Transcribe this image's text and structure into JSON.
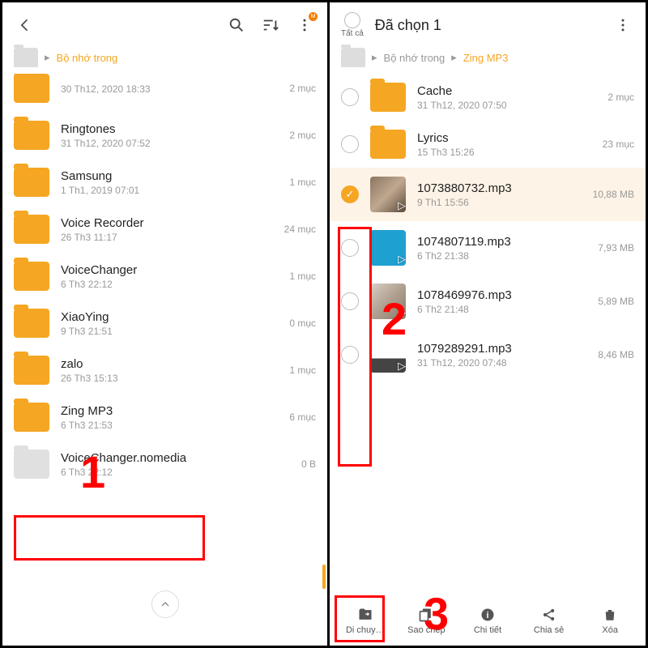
{
  "left": {
    "breadcrumb": "Bộ nhớ trong",
    "items": [
      {
        "name": "",
        "sub": "30 Th12, 2020 18:33",
        "meta": "2 mục",
        "partial": true
      },
      {
        "name": "Ringtones",
        "sub": "31 Th12, 2020 07:52",
        "meta": "2 mục"
      },
      {
        "name": "Samsung",
        "sub": "1 Th1, 2019 07:01",
        "meta": "1 mục"
      },
      {
        "name": "Voice Recorder",
        "sub": "26 Th3 11:17",
        "meta": "24 mục"
      },
      {
        "name": "VoiceChanger",
        "sub": "6 Th3 22:12",
        "meta": "1 mục"
      },
      {
        "name": "XiaoYing",
        "sub": "9 Th3 21:51",
        "meta": "0 mục"
      },
      {
        "name": "zalo",
        "sub": "26 Th3 15:13",
        "meta": "1 mục"
      },
      {
        "name": "Zing MP3",
        "sub": "6 Th3 21:53",
        "meta": "6 mục"
      },
      {
        "name": "VoiceChanger.nomedia",
        "sub": "6 Th3 22:12",
        "meta": "0 B",
        "grey": true
      }
    ]
  },
  "right": {
    "selectAllLabel": "Tất cả",
    "title": "Đã chọn 1",
    "crumb1": "Bộ nhớ trong",
    "crumb2": "Zing MP3",
    "items": [
      {
        "kind": "folder",
        "name": "Cache",
        "sub": "31 Th12, 2020 07:50",
        "meta": "2 mục"
      },
      {
        "kind": "folder",
        "name": "Lyrics",
        "sub": "15 Th3 15:26",
        "meta": "23 mục"
      },
      {
        "kind": "file",
        "name": "1073880732.mp3",
        "sub": "9 Th1 15:56",
        "meta": "10,88 MB",
        "selected": true,
        "bg": "linear-gradient(135deg,#8a7560,#c0a890,#5a4a3a)"
      },
      {
        "kind": "file",
        "name": "1074807119.mp3",
        "sub": "6 Th2 21:38",
        "meta": "7,93 MB",
        "bg": "#1ea0d0"
      },
      {
        "kind": "file",
        "name": "1078469976.mp3",
        "sub": "6 Th2 21:48",
        "meta": "5,89 MB",
        "bg": "linear-gradient(135deg,#d8d0c8,#b0a090,#8a7a6a)"
      },
      {
        "kind": "file",
        "name": "1079289291.mp3",
        "sub": "31 Th12, 2020 07:48",
        "meta": "8,46 MB",
        "bg": "linear-gradient(180deg,#fff 60%,#444 60%)"
      }
    ],
    "actions": [
      {
        "label": "Di chuy…",
        "icon": "move"
      },
      {
        "label": "Sao chép",
        "icon": "copy"
      },
      {
        "label": "Chi tiết",
        "icon": "info"
      },
      {
        "label": "Chia sẻ",
        "icon": "share"
      },
      {
        "label": "Xóa",
        "icon": "trash"
      }
    ]
  },
  "annotations": {
    "n1": "1",
    "n2": "2",
    "n3": "3"
  }
}
